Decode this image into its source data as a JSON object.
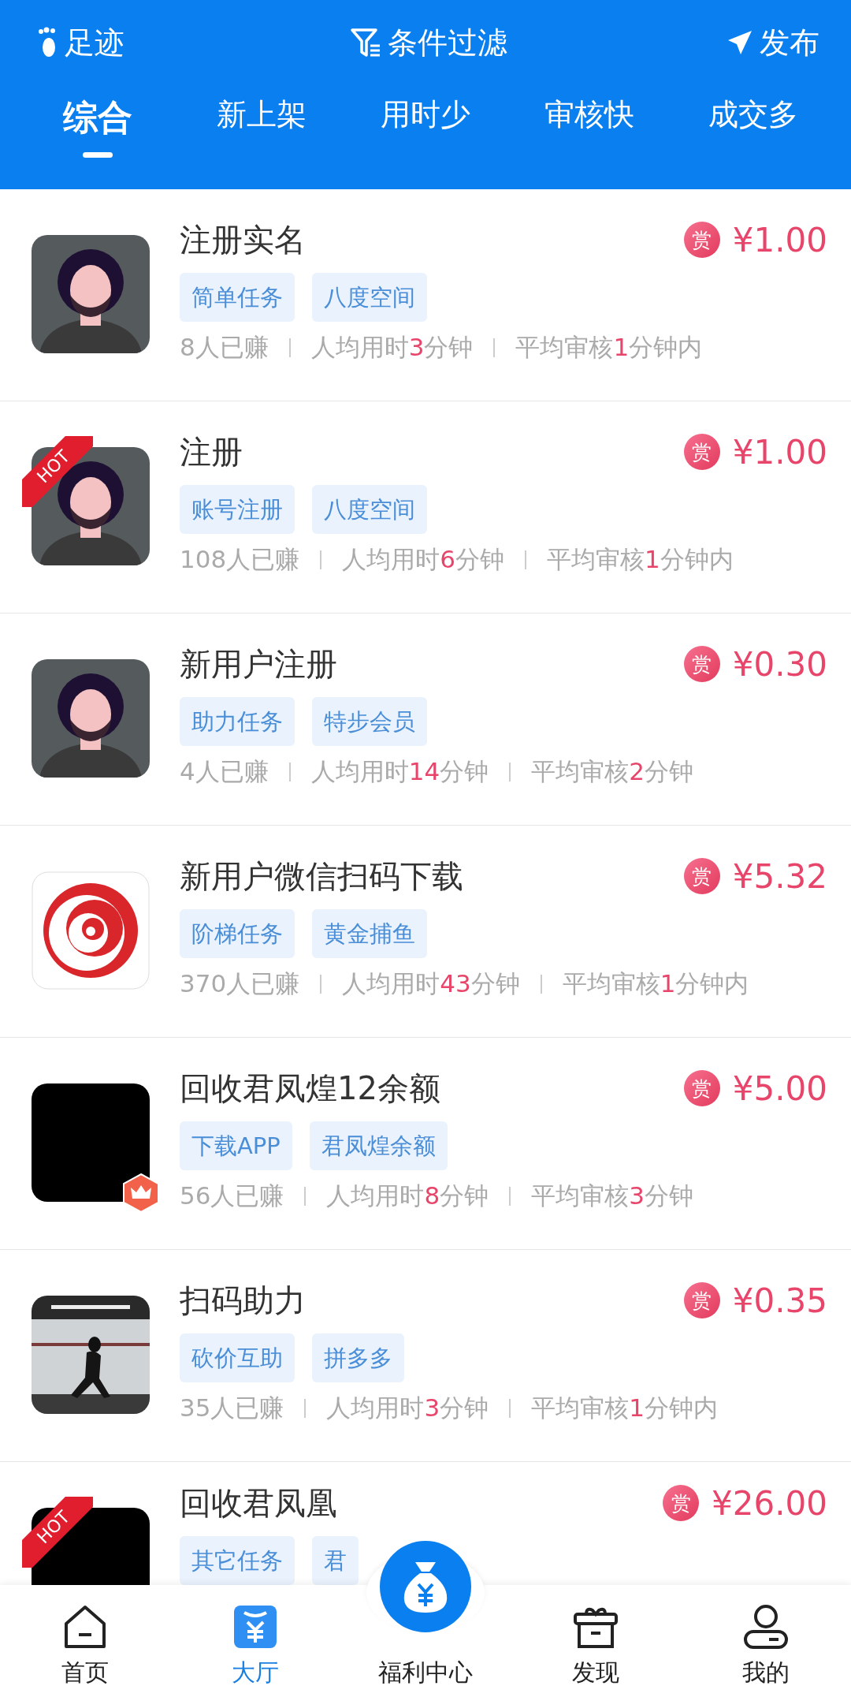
{
  "top_bar": {
    "left": "足迹",
    "center": "条件过滤",
    "right": "发布"
  },
  "tabs": [
    {
      "label": "综合",
      "selected": true
    },
    {
      "label": "新上架",
      "selected": false
    },
    {
      "label": "用时少",
      "selected": false
    },
    {
      "label": "审核快",
      "selected": false
    },
    {
      "label": "成交多",
      "selected": false
    }
  ],
  "tasks": [
    {
      "avatar": {
        "kind": "person"
      },
      "hot": false,
      "crown": false,
      "title": "注册实名",
      "reward_mark": "赏",
      "price": "¥1.00",
      "tags": [
        "简单任务",
        "八度空间"
      ],
      "earned": "8人已赚",
      "time": {
        "prefix": "人均用时",
        "value": "3",
        "suffix": "分钟"
      },
      "review": {
        "prefix": "平均审核",
        "value": "1",
        "suffix": "分钟内"
      }
    },
    {
      "avatar": {
        "kind": "person"
      },
      "hot": true,
      "hot_label": "HOT",
      "crown": false,
      "title": "注册",
      "reward_mark": "赏",
      "price": "¥1.00",
      "tags": [
        "账号注册",
        "八度空间"
      ],
      "earned": "108人已赚",
      "time": {
        "prefix": "人均用时",
        "value": "6",
        "suffix": "分钟"
      },
      "review": {
        "prefix": "平均审核",
        "value": "1",
        "suffix": "分钟内"
      }
    },
    {
      "avatar": {
        "kind": "person"
      },
      "hot": false,
      "crown": false,
      "title": "新用户注册",
      "reward_mark": "赏",
      "price": "¥0.30",
      "tags": [
        "助力任务",
        "特步会员"
      ],
      "earned": "4人已赚",
      "time": {
        "prefix": "人均用时",
        "value": "14",
        "suffix": "分钟"
      },
      "review": {
        "prefix": "平均审核",
        "value": "2",
        "suffix": "分钟"
      }
    },
    {
      "avatar": {
        "kind": "spiral"
      },
      "hot": false,
      "crown": false,
      "title": "新用户微信扫码下载",
      "reward_mark": "赏",
      "price": "¥5.32",
      "tags": [
        "阶梯任务",
        "黄金捕鱼"
      ],
      "earned": "370人已赚",
      "time": {
        "prefix": "人均用时",
        "value": "43",
        "suffix": "分钟"
      },
      "review": {
        "prefix": "平均审核",
        "value": "1",
        "suffix": "分钟内"
      }
    },
    {
      "avatar": {
        "kind": "black"
      },
      "hot": false,
      "crown": true,
      "title": "回收君凤煌12余额",
      "reward_mark": "赏",
      "price": "¥5.00",
      "tags": [
        "下载APP",
        "君凤煌余额"
      ],
      "earned": "56人已赚",
      "time": {
        "prefix": "人均用时",
        "value": "8",
        "suffix": "分钟"
      },
      "review": {
        "prefix": "平均审核",
        "value": "3",
        "suffix": "分钟"
      }
    },
    {
      "hot": false,
      "crown": false,
      "title": "扫码助力",
      "reward_mark": "赏",
      "price": "¥0.35",
      "tags": [
        "砍价互助",
        "拼多多"
      ],
      "earned": "35人已赚",
      "time": {
        "prefix": "人均用时",
        "value": "3",
        "suffix": "分钟"
      },
      "review": {
        "prefix": "平均审核",
        "value": "1",
        "suffix": "分钟内"
      }
    },
    {
      "avatar": {
        "kind": "black"
      },
      "hot": true,
      "hot_label": "HOT",
      "crown": false,
      "title": "回收君凤凰",
      "reward_mark": "赏",
      "price": "¥26.00",
      "tags": [
        "其它任务",
        "君"
      ]
    }
  ],
  "bottom_nav": [
    {
      "kind": "home",
      "label": "首页",
      "selected": false
    },
    {
      "kind": "hall",
      "label": "大厅",
      "selected": true
    },
    {
      "kind": "center",
      "label": "福利中心",
      "selected": false
    },
    {
      "kind": "discover",
      "label": "发现",
      "selected": false
    },
    {
      "kind": "profile",
      "label": "我的",
      "selected": false
    }
  ]
}
